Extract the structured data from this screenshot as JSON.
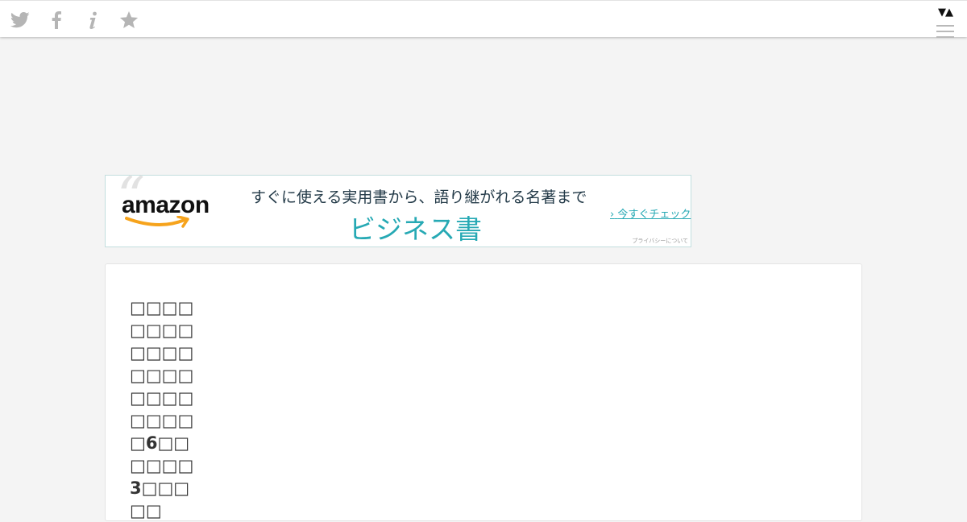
{
  "topbar": {
    "icons": [
      "twitter-icon",
      "facebook-icon",
      "info-icon",
      "star-icon"
    ],
    "arrows": "▼▲",
    "icon_color": "#b5b5b5"
  },
  "ad": {
    "brand": "amazon",
    "headline": "すぐに使える実用書から、語り継がれる名著まで",
    "category": "ビジネス書",
    "cta": "今すぐチェック",
    "privacy": "プライバシーについて",
    "accent_color": "#26a9b4",
    "smile_color": "#f6a31c"
  },
  "article": {
    "title": "□□□□□□□□□□□□□□□□□□□□□□□□□6□□□□□□3□□□□□"
  }
}
